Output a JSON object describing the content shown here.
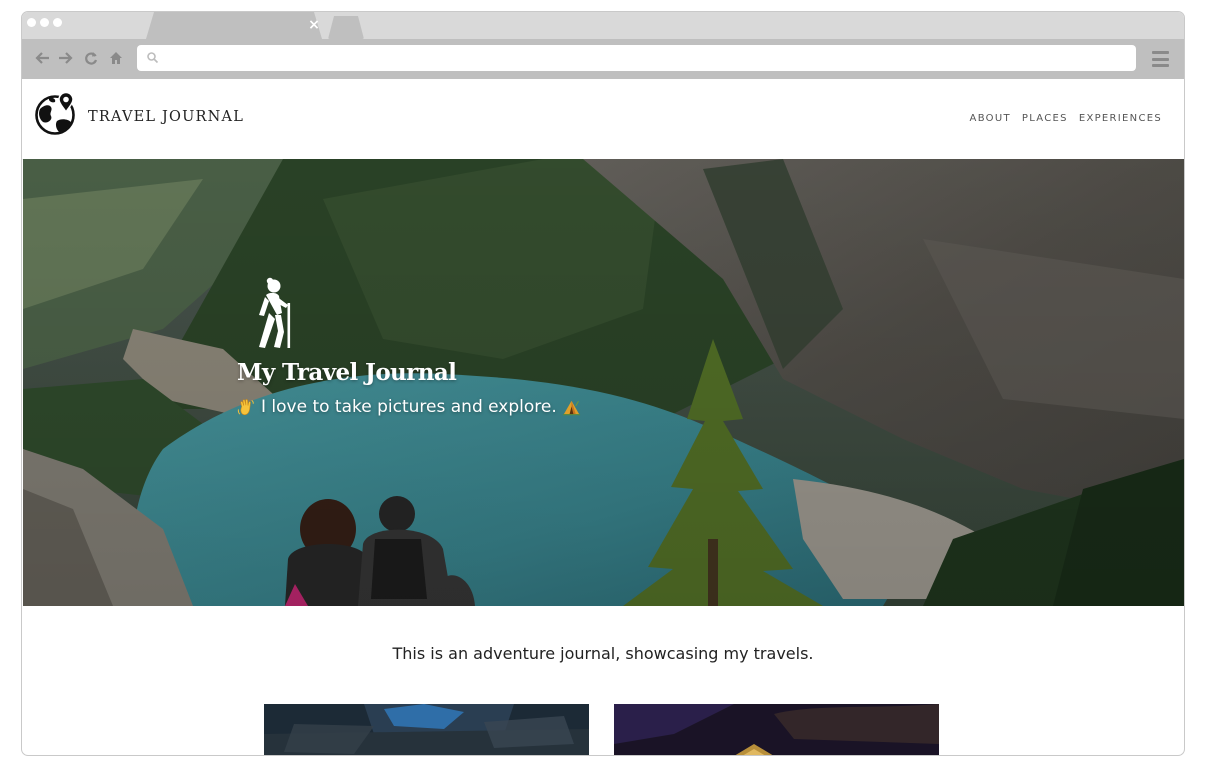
{
  "browser": {
    "tab_close_glyph": "×",
    "address_value": ""
  },
  "site": {
    "brand": "TRAVEL JOURNAL",
    "nav": [
      "ABOUT",
      "PLACES",
      "EXPERIENCES"
    ]
  },
  "hero": {
    "title": "My Travel Journal",
    "subtitle": "I love to take pictures and explore.",
    "emoji_left": "waving-hand",
    "emoji_right": "camping-tent"
  },
  "intro": "This is an adventure journal, showcasing my travels.",
  "colors": {
    "chrome_tabbar": "#d9d9d9",
    "chrome_toolbar": "#bfbfbf",
    "lake": "#3f9aa5",
    "forest": "#2f4a2b",
    "text_dark": "#222222"
  },
  "icons": [
    "back-arrow-icon",
    "forward-arrow-icon",
    "reload-icon",
    "home-icon",
    "search-icon",
    "menu-icon",
    "globe-pin-logo-icon",
    "hiker-icon"
  ]
}
